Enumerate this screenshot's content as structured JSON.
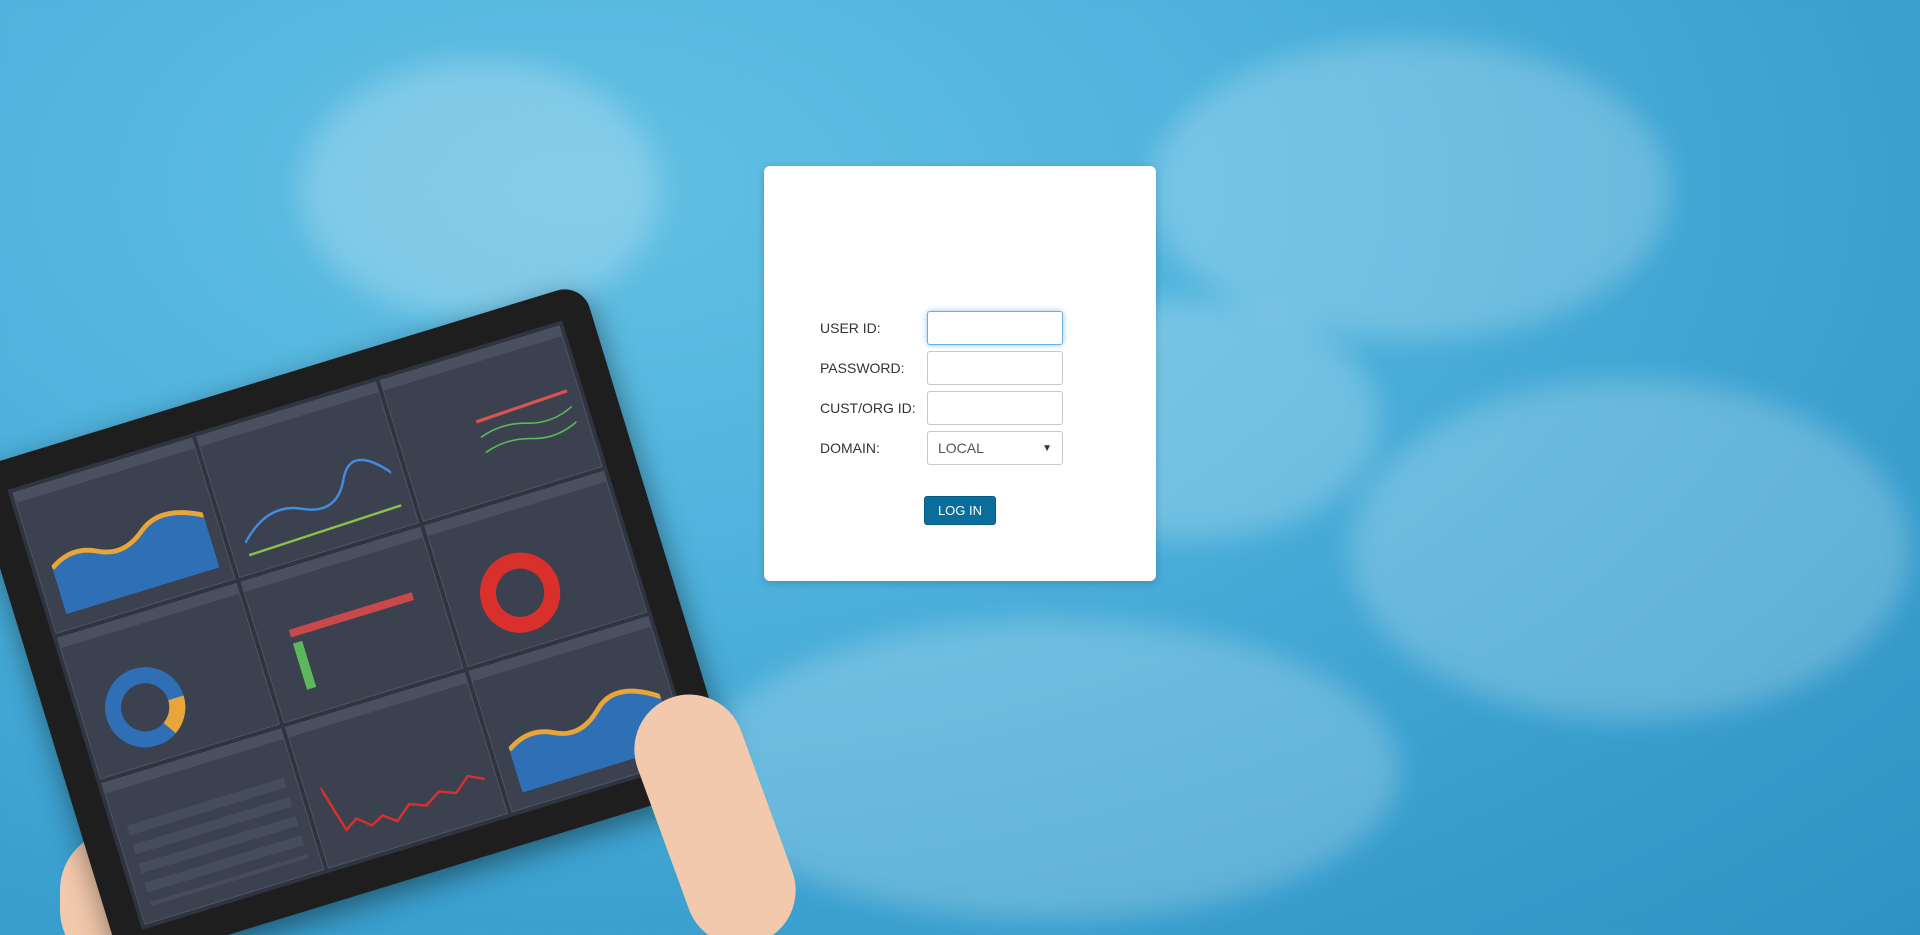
{
  "login": {
    "user_id_label": "USER ID:",
    "user_id_value": "",
    "password_label": "PASSWORD:",
    "password_value": "",
    "cust_org_label": "CUST/ORG ID:",
    "cust_org_value": "",
    "domain_label": "DOMAIN:",
    "domain_selected": "LOCAL",
    "login_button": "LOG IN"
  },
  "colors": {
    "sky": "#4fb3dd",
    "button": "#0a6e9c",
    "focus": "#66afe9"
  },
  "icons": {
    "select_arrow": "chevron-down-icon"
  }
}
